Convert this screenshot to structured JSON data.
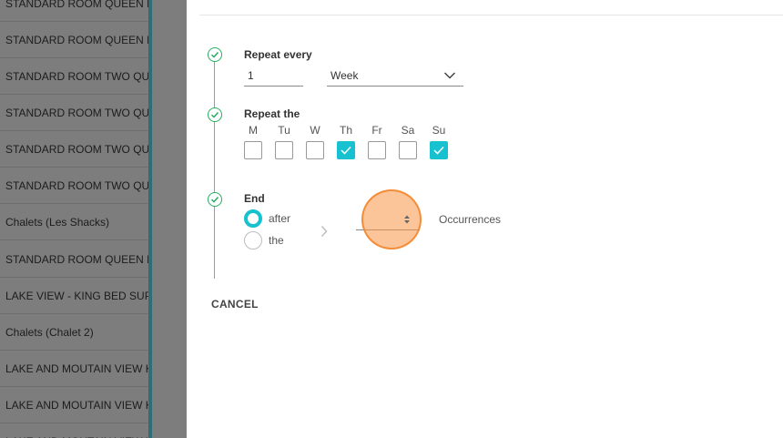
{
  "background_list": {
    "items": [
      "STANDARD ROOM QUEEN BED",
      "STANDARD ROOM QUEEN BED",
      "STANDARD ROOM TWO QUEEN",
      "STANDARD ROOM TWO QUEEN",
      "STANDARD ROOM TWO QUEEN",
      "STANDARD ROOM TWO QUEEN",
      "Chalets (Les Shacks)",
      "STANDARD ROOM QUEEN BED",
      "LAKE VIEW - KING BED SUPERIOR",
      "Chalets (Chalet 2)",
      "LAKE AND MOUTAIN VIEW KING",
      "LAKE AND MOUTAIN VIEW KING",
      "LAKE AND MOUTAIN VIEW KING"
    ]
  },
  "repeat_every": {
    "label": "Repeat every",
    "value": "1",
    "unit": "Week"
  },
  "repeat_the": {
    "label": "Repeat the",
    "days": [
      {
        "label": "M",
        "checked": false
      },
      {
        "label": "Tu",
        "checked": false
      },
      {
        "label": "W",
        "checked": false
      },
      {
        "label": "Th",
        "checked": true
      },
      {
        "label": "Fr",
        "checked": false
      },
      {
        "label": "Sa",
        "checked": false
      },
      {
        "label": "Su",
        "checked": true
      }
    ]
  },
  "end": {
    "label": "End",
    "options": [
      {
        "label": "after",
        "selected": true
      },
      {
        "label": "the",
        "selected": false
      }
    ],
    "occurrences_label": "Occurrences"
  },
  "cancel_label": "CANCEL",
  "colors": {
    "accent": "#17c1cf",
    "step_check": "#27ae60",
    "highlight": "#f89646"
  }
}
